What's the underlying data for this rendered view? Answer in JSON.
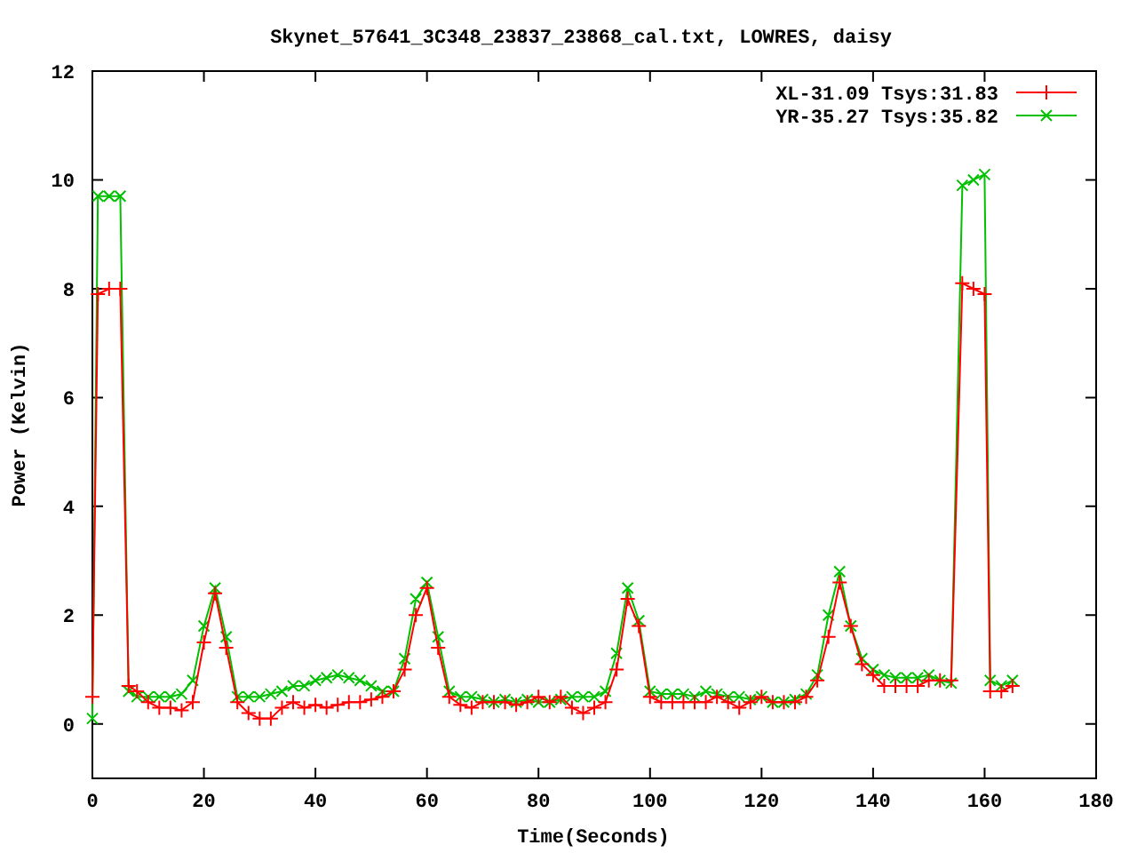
{
  "plot": {
    "chart_data": {
      "type": "line",
      "title": "Skynet_57641_3C348_23837_23868_cal.txt, LOWRES, daisy",
      "xlabel": "Time(Seconds)",
      "ylabel": "Power (Kelvin)",
      "xlim": [
        0,
        180
      ],
      "ylim": [
        -1,
        12
      ],
      "xticks": [
        0,
        20,
        40,
        60,
        80,
        100,
        120,
        140,
        160,
        180
      ],
      "yticks": [
        0,
        2,
        4,
        6,
        8,
        10,
        12
      ],
      "legend": true,
      "x": [
        0,
        1,
        3,
        5,
        6.5,
        8,
        10,
        12,
        14,
        16,
        18,
        20,
        22,
        24,
        26,
        28,
        30,
        32,
        34,
        36,
        38,
        40,
        42,
        44,
        46,
        48,
        50,
        52,
        54,
        56,
        58,
        60,
        62,
        64,
        66,
        68,
        70,
        72,
        74,
        76,
        78,
        80,
        82,
        84,
        86,
        88,
        90,
        92,
        94,
        96,
        98,
        100,
        102,
        104,
        106,
        108,
        110,
        112,
        114,
        116,
        118,
        120,
        122,
        124,
        126,
        128,
        130,
        132,
        134,
        136,
        138,
        140,
        142,
        144,
        146,
        148,
        150,
        152,
        154,
        156,
        158,
        160,
        161,
        163,
        165
      ],
      "series": [
        {
          "name": "XL-31.09 Tsys:31.83",
          "color": "#ff0000",
          "marker": "plus",
          "values": [
            0.5,
            7.9,
            8.0,
            8.0,
            0.7,
            0.6,
            0.4,
            0.3,
            0.3,
            0.25,
            0.4,
            1.5,
            2.4,
            1.4,
            0.4,
            0.2,
            0.1,
            0.1,
            0.3,
            0.4,
            0.3,
            0.35,
            0.3,
            0.35,
            0.4,
            0.4,
            0.45,
            0.5,
            0.6,
            1.0,
            2.0,
            2.5,
            1.4,
            0.5,
            0.35,
            0.3,
            0.4,
            0.4,
            0.4,
            0.35,
            0.4,
            0.5,
            0.4,
            0.5,
            0.3,
            0.2,
            0.3,
            0.4,
            1.0,
            2.3,
            1.8,
            0.5,
            0.4,
            0.4,
            0.4,
            0.4,
            0.4,
            0.5,
            0.4,
            0.3,
            0.4,
            0.5,
            0.4,
            0.4,
            0.4,
            0.5,
            0.8,
            1.6,
            2.6,
            1.8,
            1.1,
            0.9,
            0.7,
            0.7,
            0.7,
            0.7,
            0.8,
            0.8,
            0.8,
            8.1,
            8.0,
            7.9,
            0.6,
            0.6,
            0.7
          ]
        },
        {
          "name": "YR-35.27 Tsys:35.82",
          "color": "#00c000",
          "marker": "cross",
          "values": [
            0.1,
            9.7,
            9.7,
            9.7,
            0.6,
            0.5,
            0.5,
            0.5,
            0.5,
            0.55,
            0.8,
            1.8,
            2.5,
            1.6,
            0.5,
            0.5,
            0.5,
            0.55,
            0.6,
            0.7,
            0.7,
            0.8,
            0.85,
            0.9,
            0.85,
            0.8,
            0.7,
            0.6,
            0.6,
            1.2,
            2.3,
            2.6,
            1.6,
            0.6,
            0.5,
            0.5,
            0.45,
            0.4,
            0.45,
            0.4,
            0.45,
            0.4,
            0.4,
            0.45,
            0.5,
            0.5,
            0.5,
            0.6,
            1.3,
            2.5,
            1.9,
            0.6,
            0.55,
            0.55,
            0.55,
            0.5,
            0.6,
            0.55,
            0.5,
            0.5,
            0.45,
            0.5,
            0.4,
            0.4,
            0.45,
            0.55,
            0.9,
            2.0,
            2.8,
            1.8,
            1.2,
            1.0,
            0.9,
            0.85,
            0.85,
            0.85,
            0.9,
            0.8,
            0.75,
            9.9,
            10.0,
            10.1,
            0.8,
            0.7,
            0.8
          ]
        }
      ]
    }
  }
}
